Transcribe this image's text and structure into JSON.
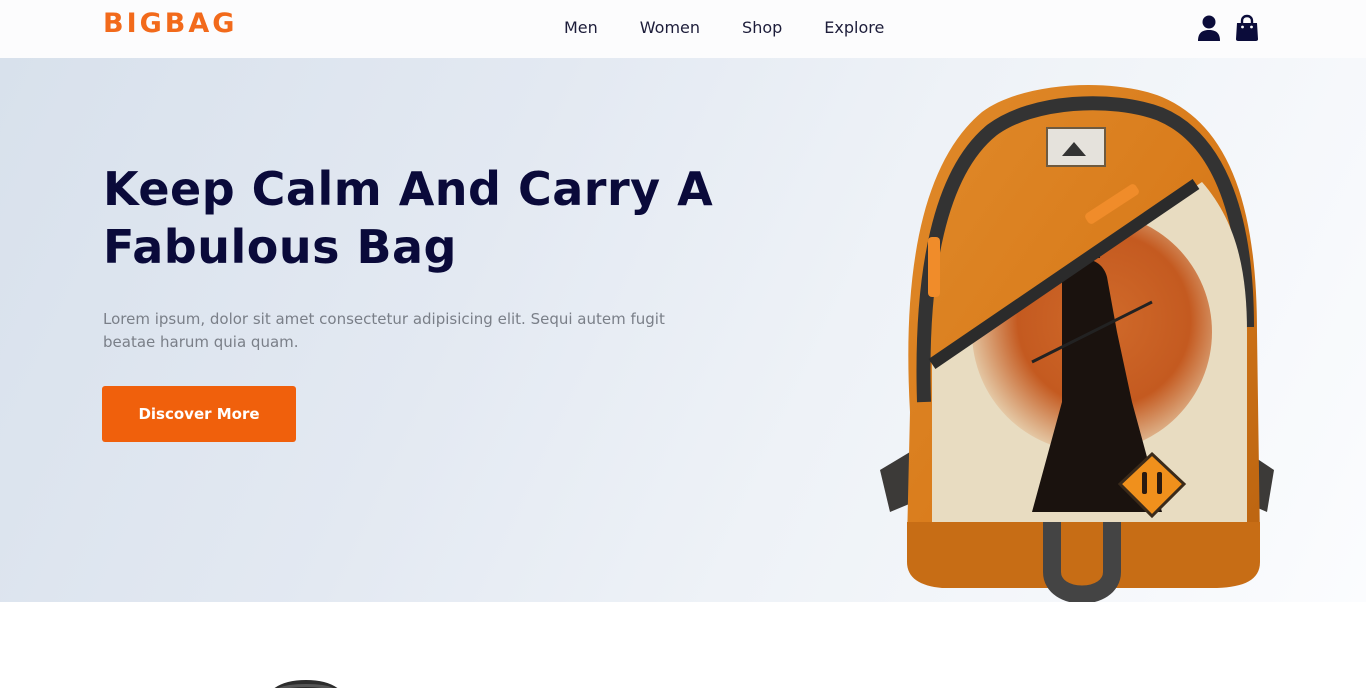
{
  "brand": {
    "name": "BIGBAG",
    "color": "#f26a1b"
  },
  "nav": {
    "items": [
      {
        "label": "Men"
      },
      {
        "label": "Women"
      },
      {
        "label": "Shop"
      },
      {
        "label": "Explore"
      }
    ]
  },
  "header_icons": {
    "user": "user-icon",
    "cart": "shopping-bag-icon"
  },
  "hero": {
    "title": "Keep Calm And Carry A Fabulous Bag",
    "description": "Lorem ipsum, dolor sit amet consectetur adipisicing elit. Sequi autem fugit beatae harum quia quam.",
    "cta_label": "Discover More",
    "cta_color": "#f0600c",
    "image": "orange-backpack-samurai-print"
  }
}
